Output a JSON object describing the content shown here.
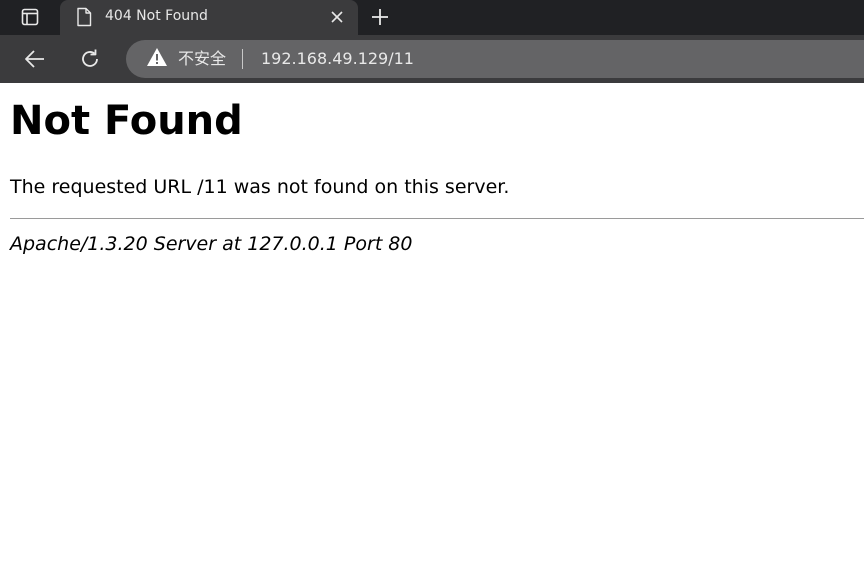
{
  "browser": {
    "tab": {
      "title": "404 Not Found"
    },
    "address_bar": {
      "security_label": "不安全",
      "url": "192.168.49.129/11"
    },
    "icons": {
      "tab_actions": "tab-actions-icon",
      "favicon": "page-document-icon",
      "close": "close-icon",
      "new_tab": "plus-icon",
      "back": "arrow-left-icon",
      "reload": "reload-icon",
      "security": "warning-triangle-icon"
    },
    "colors": {
      "tab_strip": "#202124",
      "toolbar": "#3b3b3d",
      "omnibox": "#646466"
    }
  },
  "page": {
    "heading": "Not Found",
    "message": "The requested URL /11 was not found on this server.",
    "signature": "Apache/1.3.20 Server at 127.0.0.1 Port 80"
  }
}
